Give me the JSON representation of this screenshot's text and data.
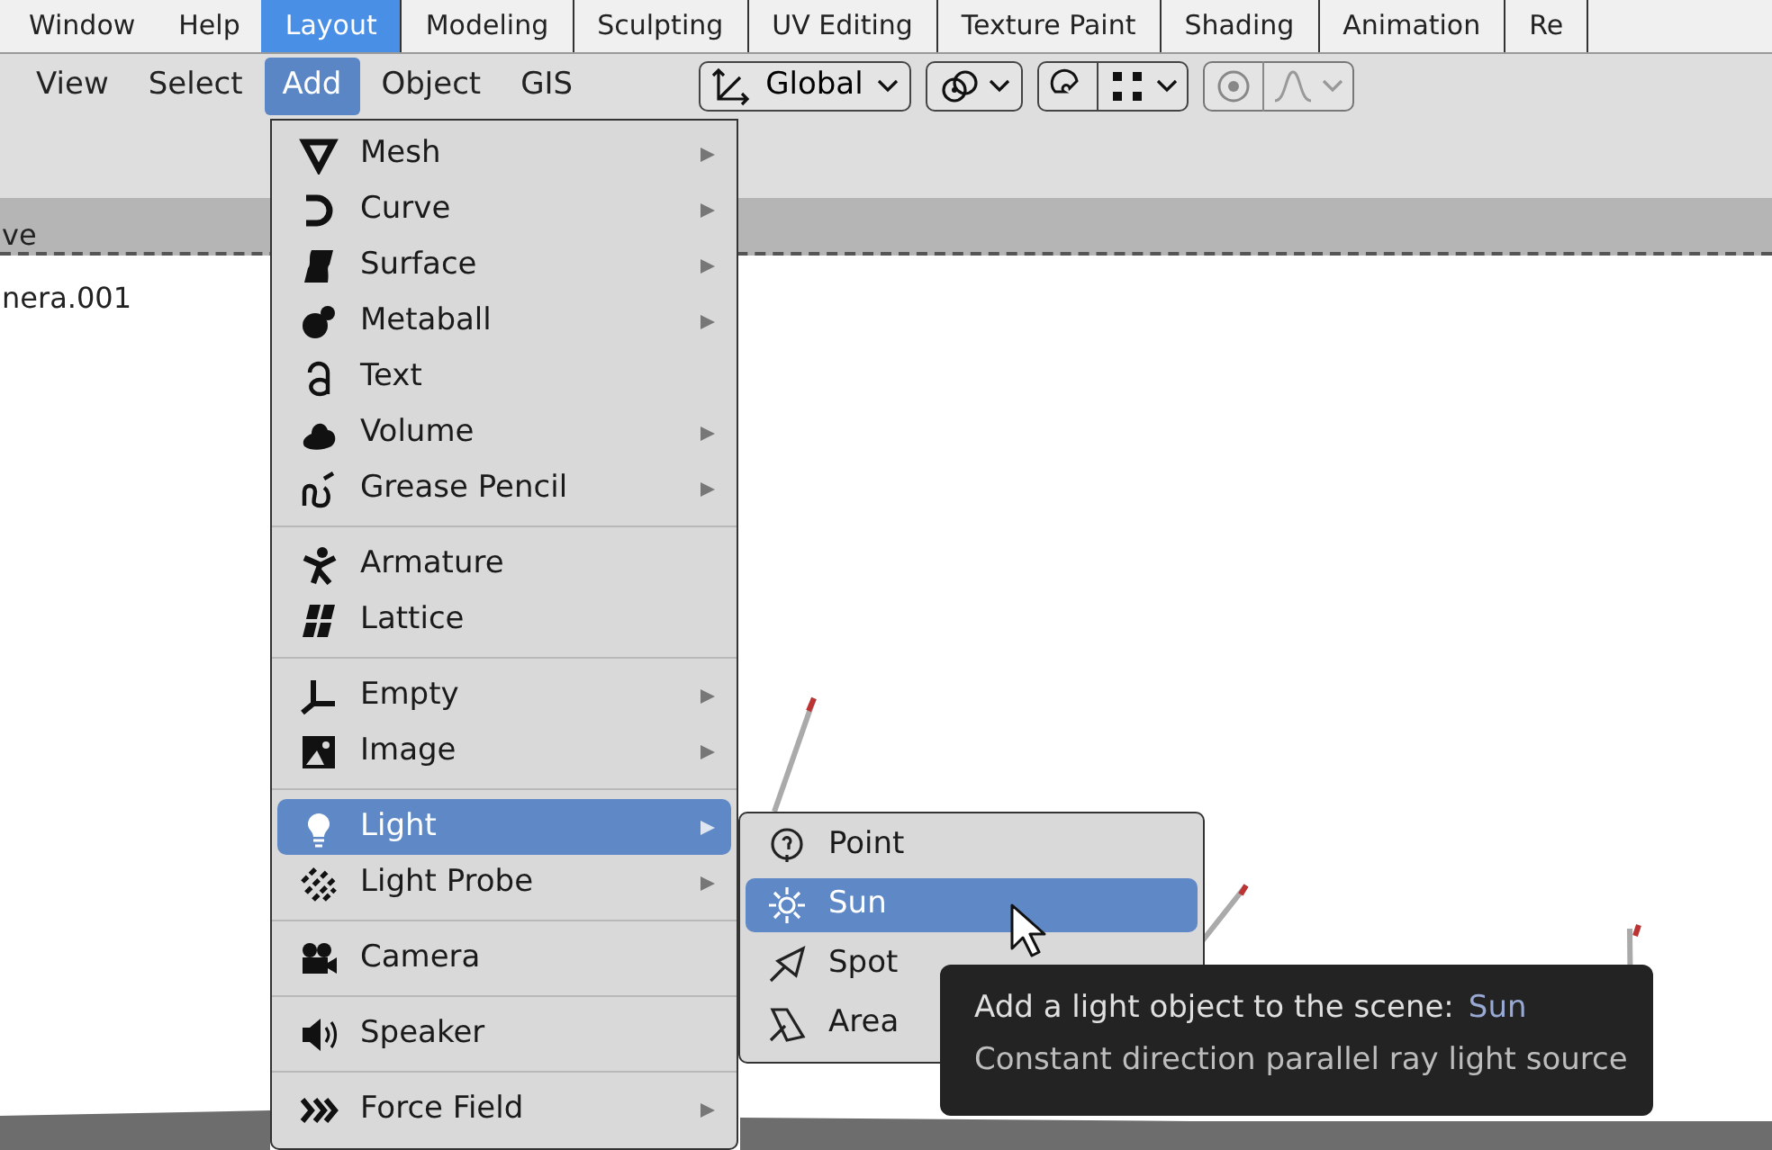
{
  "workspace_tabs": [
    {
      "label": "Window",
      "selected": false,
      "kind": "menu"
    },
    {
      "label": "Help",
      "selected": false,
      "kind": "menu"
    },
    {
      "label": "Layout",
      "selected": true,
      "kind": "tab"
    },
    {
      "label": "Modeling",
      "selected": false,
      "kind": "tab"
    },
    {
      "label": "Sculpting",
      "selected": false,
      "kind": "tab"
    },
    {
      "label": "UV Editing",
      "selected": false,
      "kind": "tab"
    },
    {
      "label": "Texture Paint",
      "selected": false,
      "kind": "tab"
    },
    {
      "label": "Shading",
      "selected": false,
      "kind": "tab"
    },
    {
      "label": "Animation",
      "selected": false,
      "kind": "tab"
    },
    {
      "label": "Re",
      "selected": false,
      "kind": "tab"
    }
  ],
  "header_menu": [
    {
      "label": "View",
      "selected": false
    },
    {
      "label": "Select",
      "selected": false
    },
    {
      "label": "Add",
      "selected": true
    },
    {
      "label": "Object",
      "selected": false
    },
    {
      "label": "GIS",
      "selected": false
    }
  ],
  "transform_orientation": {
    "value": "Global"
  },
  "outliner": {
    "header": "ve",
    "items": [
      "nera.001"
    ]
  },
  "add_menu": {
    "groups": [
      [
        {
          "label": "Mesh",
          "submenu": true,
          "selected": false
        },
        {
          "label": "Curve",
          "submenu": true,
          "selected": false
        },
        {
          "label": "Surface",
          "submenu": true,
          "selected": false
        },
        {
          "label": "Metaball",
          "submenu": true,
          "selected": false
        },
        {
          "label": "Text",
          "submenu": false,
          "selected": false
        },
        {
          "label": "Volume",
          "submenu": true,
          "selected": false
        },
        {
          "label": "Grease Pencil",
          "submenu": true,
          "selected": false
        }
      ],
      [
        {
          "label": "Armature",
          "submenu": false,
          "selected": false
        },
        {
          "label": "Lattice",
          "submenu": false,
          "selected": false
        }
      ],
      [
        {
          "label": "Empty",
          "submenu": true,
          "selected": false
        },
        {
          "label": "Image",
          "submenu": true,
          "selected": false
        }
      ],
      [
        {
          "label": "Light",
          "submenu": true,
          "selected": true
        },
        {
          "label": "Light Probe",
          "submenu": true,
          "selected": false
        }
      ],
      [
        {
          "label": "Camera",
          "submenu": false,
          "selected": false
        }
      ],
      [
        {
          "label": "Speaker",
          "submenu": false,
          "selected": false
        }
      ],
      [
        {
          "label": "Force Field",
          "submenu": true,
          "selected": false
        }
      ]
    ]
  },
  "light_submenu": [
    {
      "label": "Point",
      "selected": false
    },
    {
      "label": "Sun",
      "selected": true
    },
    {
      "label": "Spot",
      "selected": false
    },
    {
      "label": "Area",
      "selected": false
    }
  ],
  "tooltip": {
    "title": "Add a light object to the scene:",
    "value": "Sun",
    "description": "Constant direction parallel ray light source"
  }
}
